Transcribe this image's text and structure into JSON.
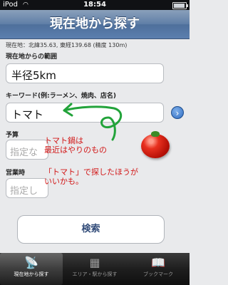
{
  "status": {
    "carrier": "iPod",
    "wifi": "wifi-icon",
    "time": "18:54"
  },
  "nav": {
    "title": "現在地から探す"
  },
  "location": "現在地：北緯35.63, 東経139.68 (精度 130m)",
  "range": {
    "label": "現在地からの範囲",
    "value": "半径5km"
  },
  "keyword": {
    "label": "キーワード(例:ラーメン、焼肉、店名)",
    "value": "トマト"
  },
  "budget": {
    "label": "予算",
    "placeholder": "指定な"
  },
  "hours": {
    "label": "営業時",
    "placeholder": "指定し"
  },
  "notes": {
    "line1": "トマト鍋は",
    "line2": "最近はやりのもの",
    "line3": "「トマト」で探したほうが",
    "line4": "いいかも。"
  },
  "search_label": "検索",
  "tabs": [
    {
      "label": "現在地から探す",
      "icon": "satellite-dish-icon"
    },
    {
      "label": "エリア・駅から探す",
      "icon": "area-icon"
    },
    {
      "label": "ブックマーク",
      "icon": "book-icon"
    }
  ],
  "colors": {
    "nav": "#5f7ea7",
    "annotation": "#d21616",
    "arrow": "#22a33a"
  }
}
